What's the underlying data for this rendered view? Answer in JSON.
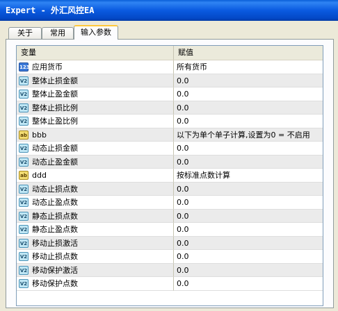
{
  "window": {
    "title": "Expert - 外汇风控EA"
  },
  "tabs": [
    {
      "label": "关于",
      "active": false
    },
    {
      "label": "常用",
      "active": false
    },
    {
      "label": "输入参数",
      "active": true
    }
  ],
  "grid": {
    "columns": {
      "variable": "变量",
      "value": "赋值"
    },
    "rows": [
      {
        "icon": "int-type-icon",
        "name": "应用货币",
        "value": "所有货币"
      },
      {
        "icon": "double-type-icon",
        "name": "整体止损金额",
        "value": "0.0"
      },
      {
        "icon": "double-type-icon",
        "name": "整体止盈金额",
        "value": "0.0"
      },
      {
        "icon": "double-type-icon",
        "name": "整体止损比例",
        "value": "0.0"
      },
      {
        "icon": "double-type-icon",
        "name": "整体止盈比例",
        "value": "0.0"
      },
      {
        "icon": "string-type-icon",
        "name": "bbb",
        "value": "以下为单个单子计算,设置为0 = 不启用"
      },
      {
        "icon": "double-type-icon",
        "name": "动态止损金额",
        "value": "0.0"
      },
      {
        "icon": "double-type-icon",
        "name": "动态止盈金额",
        "value": "0.0"
      },
      {
        "icon": "string-type-icon",
        "name": "ddd",
        "value": "按标准点数计算"
      },
      {
        "icon": "double-type-icon",
        "name": "动态止损点数",
        "value": "0.0"
      },
      {
        "icon": "double-type-icon",
        "name": "动态止盈点数",
        "value": "0.0"
      },
      {
        "icon": "double-type-icon",
        "name": "静态止损点数",
        "value": "0.0"
      },
      {
        "icon": "double-type-icon",
        "name": "静态止盈点数",
        "value": "0.0"
      },
      {
        "icon": "double-type-icon",
        "name": "移动止损激活",
        "value": "0.0"
      },
      {
        "icon": "double-type-icon",
        "name": "移动止损点数",
        "value": "0.0"
      },
      {
        "icon": "double-type-icon",
        "name": "移动保护激活",
        "value": "0.0"
      },
      {
        "icon": "double-type-icon",
        "name": "移动保护点数",
        "value": "0.0"
      }
    ]
  }
}
